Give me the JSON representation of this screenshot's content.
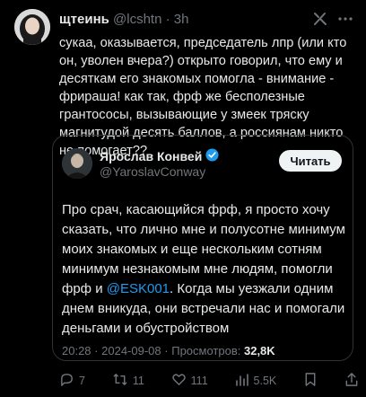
{
  "author": {
    "name": "щтеинь",
    "handle": "@lcshtn",
    "separator": "·",
    "time": "3h"
  },
  "post": {
    "text": "сукаа, оказывается, председатель лпр (или кто он, уволен вчера?) открыто говорил, что ему и десяткам его знакомых помогла - внимание - фрираша! как так, фрф же бесполезные грантососы, вызывающие у змеек тряску магнитудой десять баллов, а россиянам никто не помогает??"
  },
  "quote": {
    "name": "Ярослав Конвей",
    "handle": "@YaroslavConway",
    "read_button": "Читать",
    "text_before": "Про срач, касающийся фрф, я просто хочу сказать, что лично мне и полусотне минимум моих знакомых и еще нескольким сотням минимум незнакомым мне людям, помогли фрф и ",
    "mention": "@ESK001",
    "text_after": ". Когда мы уезжали одним днем вникуда, они встречали нас и помогали деньгами и обустройством",
    "time": "20:28",
    "sep": "·",
    "date": "2024-09-08",
    "sep2": "·",
    "views_label": "Просмотров:",
    "views_count": "32,8K"
  },
  "actions": {
    "replies": "7",
    "reposts": "11",
    "likes": "111",
    "views": "5.5K"
  },
  "colors": {
    "background": "#000000",
    "text": "#e7e9ea",
    "muted": "#71767b",
    "accent": "#1d9bf0",
    "border": "#2f3336",
    "button_bg": "#eff3f4"
  },
  "icons": [
    "grok-icon",
    "more-icon",
    "verified-badge-icon",
    "reply-icon",
    "repost-icon",
    "like-icon",
    "views-icon",
    "bookmark-icon",
    "share-icon"
  ]
}
